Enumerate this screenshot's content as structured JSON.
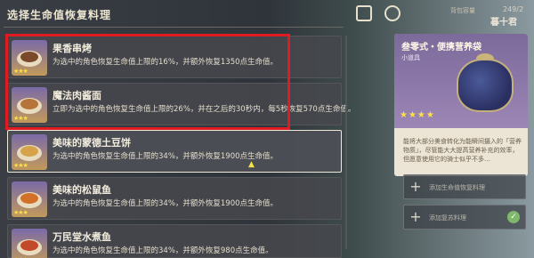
{
  "left_panel": {
    "title": "选择生命值恢复料理",
    "foods": [
      {
        "name": "果香串烤",
        "desc": "为选中的角色恢复生命值上限的16%，并额外恢复1350点生命值。",
        "stars": "★★★",
        "dish_color": "#7a4a2a"
      },
      {
        "name": "魔法肉酱面",
        "desc": "立即为选中的角色恢复生命值上限的26%，并在之后的30秒内，每5秒恢复570点生命值。",
        "stars": "★★★",
        "dish_color": "#b7743a"
      },
      {
        "name": "美味的蒙德土豆饼",
        "desc": "为选中的角色恢复生命值上限的34%，并额外恢复1900点生命值。",
        "stars": "★★★",
        "dish_color": "#d6a24a"
      },
      {
        "name": "美味的松鼠鱼",
        "desc": "为选中的角色恢复生命值上限的34%，并额外恢复1900点生命值。",
        "stars": "★★★",
        "dish_color": "#d2702a"
      },
      {
        "name": "万民堂水煮鱼",
        "desc": "为选中的角色恢复生命值上限的34%，并额外恢复980点生命值。",
        "stars": "★★★",
        "dish_color": "#c24a2a"
      }
    ]
  },
  "top_bar": {
    "bag_label": "背包容量",
    "page_count": "249/2",
    "bag_name": "暮十君"
  },
  "detail_card": {
    "title": "叁零式・便携营养袋",
    "subtitle": "小道具",
    "stars": "★★★★",
    "desc": "能将大部分美食转化为能瞬间摄入的「营养物质」，尽管能大大提高营养补充的效率，但愿意使用它的骑士似乎不多…"
  },
  "slots": [
    {
      "text": "添加生命值恢复料理"
    },
    {
      "text": "添加复苏料理"
    }
  ],
  "colors": {
    "highlight": "#e11b22",
    "star": "#fce04a"
  }
}
